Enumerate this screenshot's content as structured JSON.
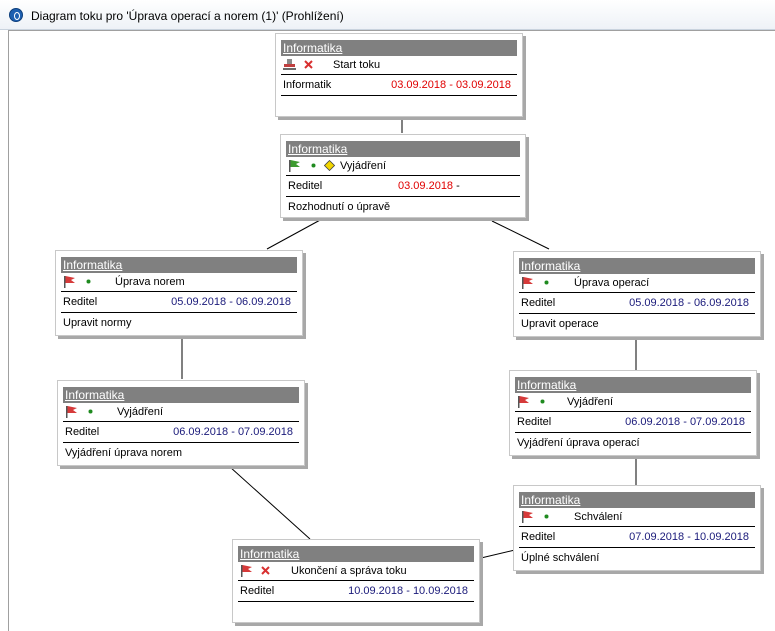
{
  "window": {
    "title": "Diagram toku pro 'Úprava operací a norem (1)' (Prohlížení)"
  },
  "nodes": {
    "start": {
      "header": "Informatika",
      "main_icon": "stamp-icon",
      "status_icon": "x-icon",
      "name": "Start toku",
      "role": "Informatik",
      "date_from": "03.09.2018",
      "sep": " - ",
      "date_to": "03.09.2018",
      "note": ""
    },
    "vyjadreni_top": {
      "header": "Informatika",
      "main_icon": "green-flag-icon",
      "status_icon": "green-dot-icon",
      "extra_icon": "yellow-diamond-icon",
      "name": "Vyjádření",
      "role": "Reditel",
      "date_from": "03.09.2018",
      "sep": " -",
      "date_to": "",
      "note": "Rozhodnutí o úpravě"
    },
    "uprava_norem": {
      "header": "Informatika",
      "main_icon": "red-flag-icon",
      "status_icon": "green-dot-icon",
      "name": "Úprava norem",
      "role": "Reditel",
      "date_from": "05.09.2018",
      "sep": " - ",
      "date_to": "06.09.2018",
      "note": "Upravit normy"
    },
    "uprava_operaci": {
      "header": "Informatika",
      "main_icon": "red-flag-icon",
      "status_icon": "green-dot-icon",
      "name": "Úprava operací",
      "role": "Reditel",
      "date_from": "05.09.2018",
      "sep": " - ",
      "date_to": "06.09.2018",
      "note": "Upravit operace"
    },
    "vyjadreni_left": {
      "header": "Informatika",
      "main_icon": "red-flag-icon",
      "status_icon": "green-dot-icon",
      "name": "Vyjádření",
      "role": "Reditel",
      "date_from": "06.09.2018",
      "sep": " - ",
      "date_to": "07.09.2018",
      "note": "Vyjádření úprava norem"
    },
    "vyjadreni_right": {
      "header": "Informatika",
      "main_icon": "red-flag-icon",
      "status_icon": "green-dot-icon",
      "name": "Vyjádření",
      "role": "Reditel",
      "date_from": "06.09.2018",
      "sep": " - ",
      "date_to": "07.09.2018",
      "note": "Vyjádření úprava operací"
    },
    "schvaleni": {
      "header": "Informatika",
      "main_icon": "red-flag-icon",
      "status_icon": "green-dot-icon",
      "name": "Schválení",
      "role": "Reditel",
      "date_from": "07.09.2018",
      "sep": " - ",
      "date_to": "10.09.2018",
      "note": "Úplné schválení"
    },
    "ukonceni": {
      "header": "Informatika",
      "main_icon": "red-flag-icon",
      "status_icon": "x-icon",
      "name": "Ukončení a správa toku",
      "role": "Reditel",
      "date_from": "10.09.2018",
      "sep": " - ",
      "date_to": "10.09.2018",
      "note": ""
    }
  },
  "colors": {
    "header_bg": "#808080",
    "overdue_date": "#e00000",
    "planned_date": "#1a1a7a",
    "flag_red": "#d63a3a",
    "flag_green": "#3c9a2e",
    "status_dot": "#1f8a1f",
    "cancel_x": "#d83030",
    "diamond": "#f2d600"
  }
}
